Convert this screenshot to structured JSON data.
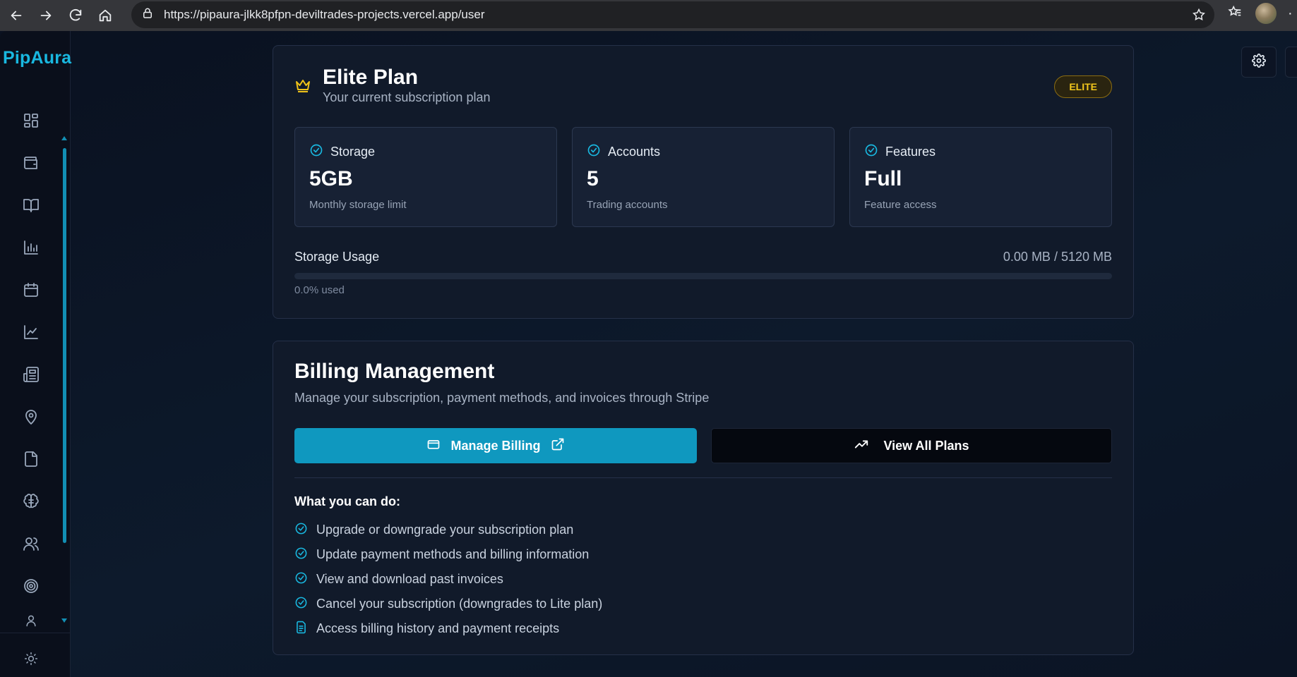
{
  "browser": {
    "url": "https://pipaura-jlkk8pfpn-deviltrades-projects.vercel.app/user"
  },
  "sidebar": {
    "logo": "PipAura",
    "icons": [
      "dashboard-icon",
      "wallet-icon",
      "book-icon",
      "bar-chart-icon",
      "calendar-icon",
      "line-chart-icon",
      "newspaper-icon",
      "map-pin-icon",
      "file-icon",
      "brain-icon",
      "users-icon",
      "target-icon",
      "user-icon",
      "sun-icon"
    ]
  },
  "plan": {
    "title": "Elite Plan",
    "subtitle": "Your current subscription plan",
    "badge": "ELITE",
    "stats": [
      {
        "label": "Storage",
        "value": "5GB",
        "desc": "Monthly storage limit"
      },
      {
        "label": "Accounts",
        "value": "5",
        "desc": "Trading accounts"
      },
      {
        "label": "Features",
        "value": "Full",
        "desc": "Feature access"
      }
    ],
    "usage": {
      "label": "Storage Usage",
      "amount": "0.00 MB / 5120 MB",
      "percent_text": "0.0% used",
      "percent_value": 0
    }
  },
  "billing": {
    "title": "Billing Management",
    "subtitle": "Manage your subscription, payment methods, and invoices through Stripe",
    "manage_label": "Manage Billing",
    "plans_label": "View All Plans",
    "can_title": "What you can do:",
    "items": [
      "Upgrade or downgrade your subscription plan",
      "Update payment methods and billing information",
      "View and download past invoices",
      "Cancel your subscription (downgrades to Lite plan)",
      "Access billing history and payment receipts"
    ]
  },
  "colors": {
    "accent": "#19b8e0",
    "button": "#0f98bf",
    "badge": "#f2c71c"
  }
}
